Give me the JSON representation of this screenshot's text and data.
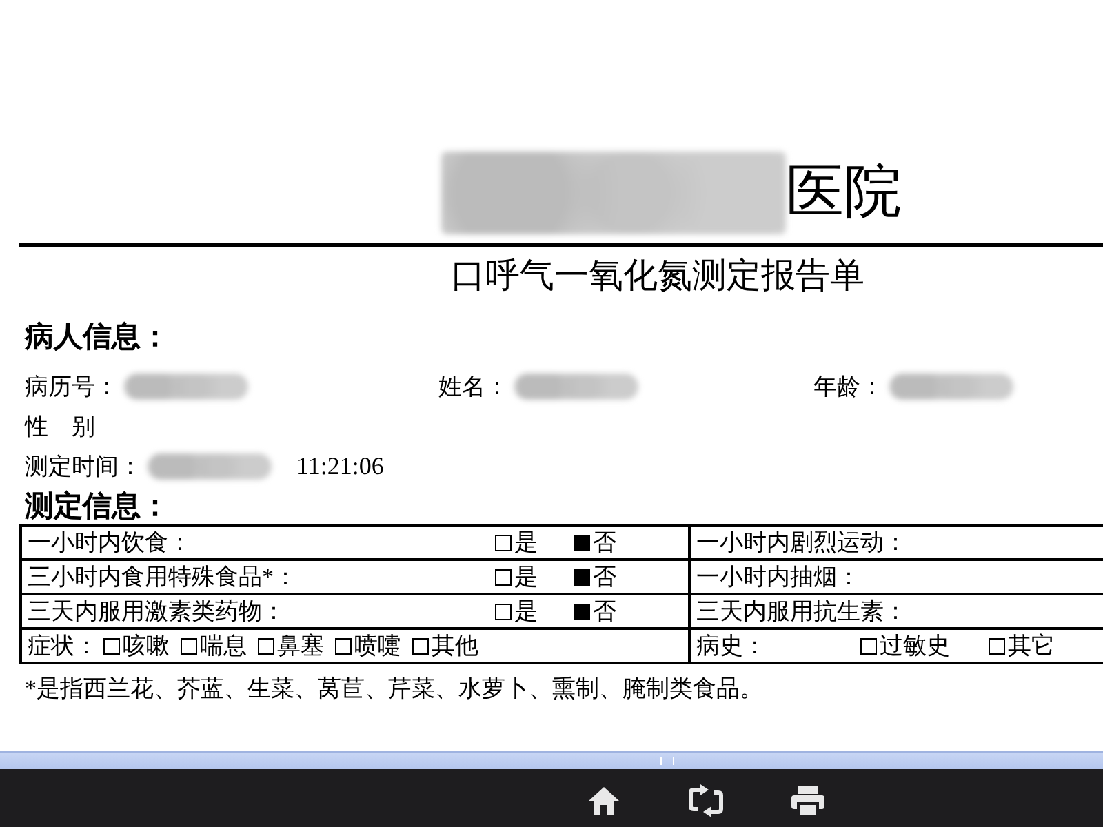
{
  "header": {
    "hospital_name_redacted": true,
    "hospital_suffix": "医院",
    "report_title": "口呼气一氧化氮测定报告单"
  },
  "patient_info": {
    "heading": "病人信息：",
    "rows": [
      [
        {
          "label": "病历号：",
          "redacted": true
        },
        {
          "label": "姓名：",
          "redacted": true
        },
        {
          "label": "年龄：",
          "redacted": true
        }
      ],
      [
        {
          "label": "性　别",
          "redacted": false
        }
      ],
      [
        {
          "label": "测定时间：",
          "redacted": true,
          "value": "11:21:06"
        }
      ]
    ]
  },
  "measurement_info": {
    "heading": "测定信息：",
    "rows": [
      {
        "kind": "question",
        "left": {
          "label": "一小时内饮食：",
          "options": [
            {
              "label": "是",
              "checked": false
            },
            {
              "label": "否",
              "checked": true
            }
          ]
        },
        "right": {
          "label": "一小时内剧烈运动："
        }
      },
      {
        "kind": "question",
        "left": {
          "label": "三小时内食用特殊食品*：",
          "options": [
            {
              "label": "是",
              "checked": false
            },
            {
              "label": "否",
              "checked": true
            }
          ]
        },
        "right": {
          "label": "一小时内抽烟："
        }
      },
      {
        "kind": "question",
        "left": {
          "label": "三天内服用激素类药物：",
          "options": [
            {
              "label": "是",
              "checked": false
            },
            {
              "label": "否",
              "checked": true
            }
          ]
        },
        "right": {
          "label": "三天内服用抗生素："
        }
      },
      {
        "kind": "checklist",
        "left": {
          "label": "症状：",
          "options": [
            {
              "label": "咳嗽",
              "checked": false
            },
            {
              "label": "喘息",
              "checked": false
            },
            {
              "label": "鼻塞",
              "checked": false
            },
            {
              "label": "喷嚏",
              "checked": false
            },
            {
              "label": "其他",
              "checked": false
            }
          ]
        },
        "right": {
          "label": "病史：",
          "options": [
            {
              "label": "过敏史",
              "checked": false
            },
            {
              "label": "其它",
              "checked": false
            }
          ]
        }
      }
    ],
    "footnote": "*是指西兰花、芥蓝、生菜、莴苣、芹菜、水萝卜、熏制、腌制类食品。"
  },
  "toolbar": {
    "buttons": [
      {
        "kind": "home"
      },
      {
        "kind": "refresh"
      },
      {
        "kind": "print"
      }
    ]
  }
}
